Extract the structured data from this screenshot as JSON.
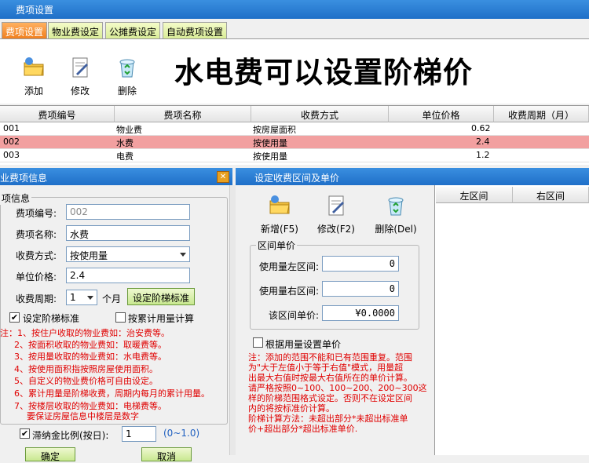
{
  "window": {
    "title": "费项设置"
  },
  "tabs": [
    {
      "label": "费项设置"
    },
    {
      "label": "物业费设定"
    },
    {
      "label": "公摊费设定"
    },
    {
      "label": "自动费项设置"
    }
  ],
  "toolbar": {
    "add_label": "添加",
    "edit_label": "修改",
    "delete_label": "删除"
  },
  "banner": {
    "text": "水电费可以设置阶梯价"
  },
  "table": {
    "columns": [
      "费项编号",
      "费项名称",
      "收费方式",
      "单位价格",
      "收费周期（月）"
    ],
    "rows": [
      {
        "code": "001",
        "name": "物业费",
        "method": "按房屋面积",
        "price": "0.62"
      },
      {
        "code": "002",
        "name": "水费",
        "method": "按使用量",
        "price": "2.4"
      },
      {
        "code": "003",
        "name": "电费",
        "method": "按使用量",
        "price": "1.2"
      }
    ]
  },
  "left_panel": {
    "title": "物业费项信息",
    "group_label": "项信息",
    "code_label": "费项编号:",
    "code_value": "002",
    "name_label": "费项名称:",
    "name_value": "水费",
    "method_label": "收费方式:",
    "method_value": "按使用量",
    "price_label": "单位价格:",
    "price_value": "2.4",
    "cycle_label": "收费周期:",
    "cycle_value": "1",
    "cycle_unit": "个月",
    "ladder_button": "设定阶梯标准",
    "ladder_check_label": "设定阶梯标准",
    "cumulative_check_label": "按累计用量计算",
    "notes": [
      "注：1、按住户收取的物业费如：治安费等。",
      "2、按面积收取的物业费如：取暖费等。",
      "3、按用量收取的物业费如：水电费等。",
      "4、按使用面积指按照房屋使用面积。",
      "5、自定义的物业费价格可自由设定。",
      "6、累计用量是阶梯收费，周期内每月的累计用量。",
      "7、按楼层收取的物业费如：电梯费等。",
      "要保证房屋信息中楼层是数字"
    ],
    "late_fee_label": "滞纳金比例(按日):",
    "late_fee_value": "1",
    "late_fee_range": "(0~1.0)",
    "ok_button": "确定",
    "cancel_button": "取消"
  },
  "right_panel": {
    "title": "设定收费区间及单价",
    "add_label": "新增(F5)",
    "edit_label": "修改(F2)",
    "delete_label": "删除(Del)",
    "group_label": "区间单价",
    "left_label": "使用量左区间:",
    "left_value": "0",
    "right_label": "使用量右区间:",
    "right_value": "0",
    "price_label": "该区间单价:",
    "price_value": "¥0.0000",
    "by_usage_label": "根据用量设置单价",
    "notes": [
      "注：添加的范围不能和已有范围重复。范围",
      "为\"大于左值小于等于右值\"模式，用量超",
      "出最大右值时按最大右值所在的单价计算。",
      "请严格按照0~100、100~200、200~300这",
      "样的阶梯范围格式设定。否则不在设定区间",
      "内的将按标准价计算。",
      "阶梯计算方法：未超出部分*未超出标准单",
      "价+超出部分*超出标准单价."
    ],
    "grid_columns": [
      "左区间",
      "右区间"
    ]
  }
}
